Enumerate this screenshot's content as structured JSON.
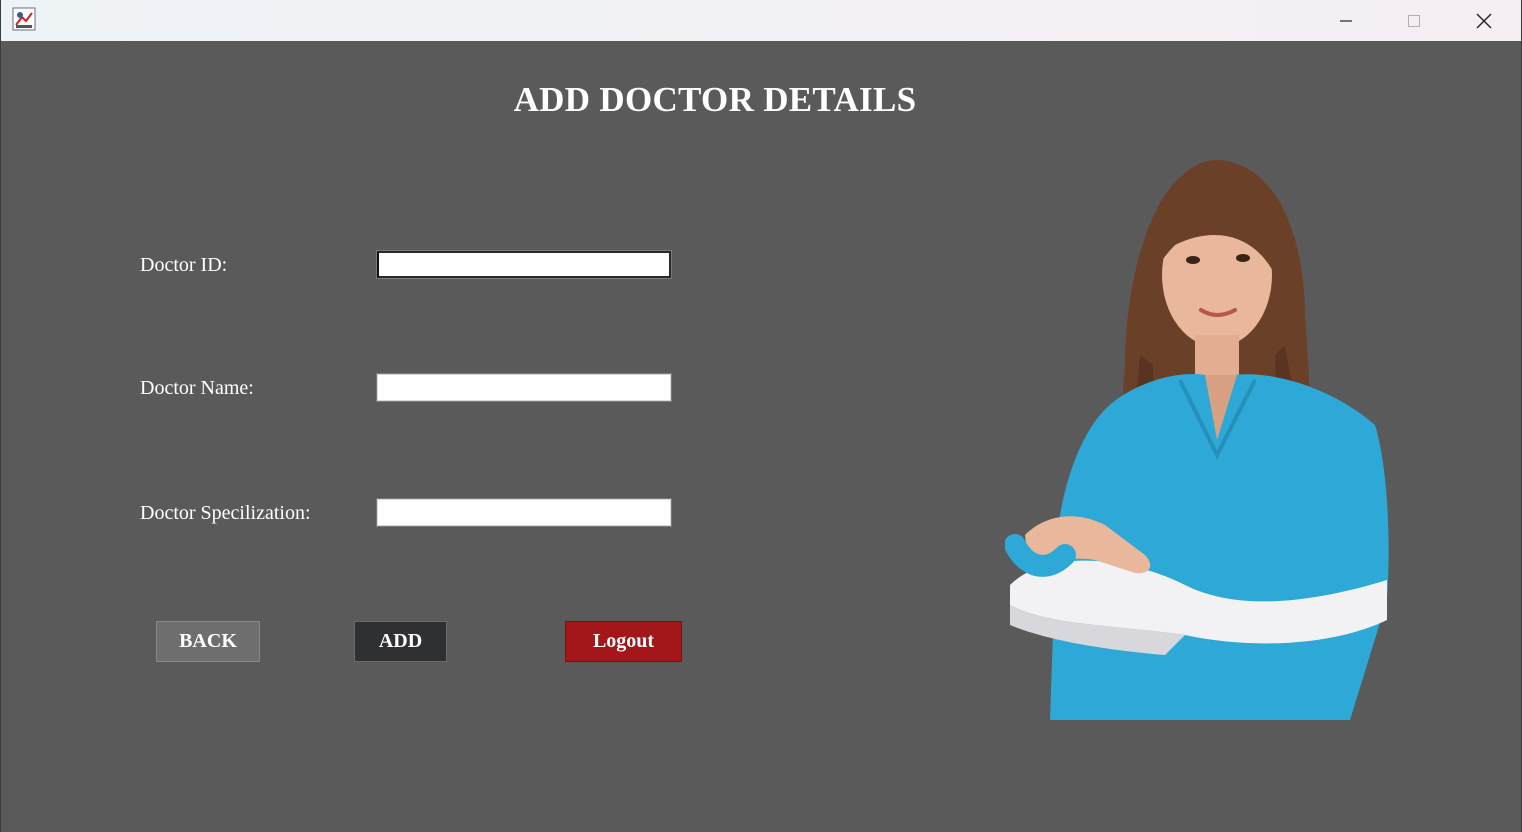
{
  "window": {
    "title_bar": {
      "icon": "java-app-icon",
      "controls": [
        "minimize-icon",
        "maximize-icon",
        "close-icon"
      ]
    }
  },
  "form": {
    "heading": "ADD DOCTOR DETAILS",
    "fields": [
      {
        "label": "Doctor ID:",
        "value": "",
        "placeholder": ""
      },
      {
        "label": "Doctor Name:",
        "value": "",
        "placeholder": ""
      },
      {
        "label": "Doctor Specilization:",
        "value": "",
        "placeholder": ""
      }
    ],
    "buttons": {
      "back": "BACK",
      "add": "ADD",
      "logout": "Logout"
    }
  },
  "colors": {
    "background": "#5a5a5a",
    "back_button": "#6e6e6e",
    "add_button": "#2f3032",
    "logout_button": "#a3171a",
    "scrubs": "#2ea8d6"
  },
  "image": {
    "subject": "doctor-photo"
  }
}
